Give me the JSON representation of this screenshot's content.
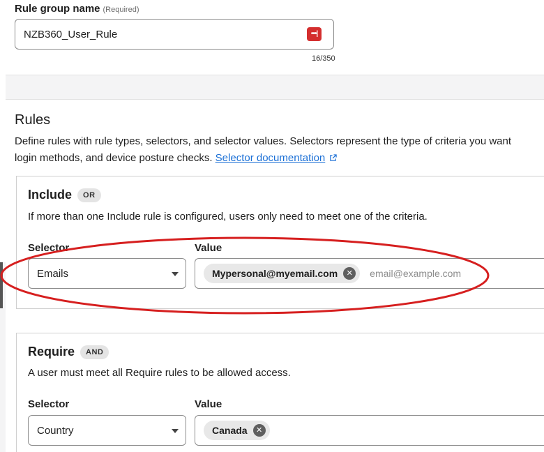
{
  "rule_group": {
    "label": "Rule group name",
    "required": "(Required)",
    "value": "NZB360_User_Rule",
    "counter": "16/350"
  },
  "rules": {
    "title": "Rules",
    "desc_line1": "Define rules with rule types, selectors, and selector values. Selectors represent the type of criteria you want",
    "desc_line2": "login methods, and device posture checks.",
    "doc_link": "Selector documentation"
  },
  "include": {
    "title": "Include",
    "badge": "OR",
    "desc": "If more than one Include rule is configured, users only need to meet one of the criteria.",
    "selector_label": "Selector",
    "value_label": "Value",
    "selector_value": "Emails",
    "chip": "Mypersonal@myemail.com",
    "placeholder": "email@example.com"
  },
  "require": {
    "title": "Require",
    "badge": "AND",
    "desc": "A user must meet all Require rules to be allowed access.",
    "selector_label": "Selector",
    "value_label": "Value",
    "selector_value": "Country",
    "chip": "Canada"
  },
  "colors": {
    "annotation": "#d61f1f",
    "link": "#1a6fd6",
    "password_icon": "#d42e2e"
  },
  "icons": [
    "password-manager-icon",
    "external-link-icon",
    "chevron-down-icon",
    "remove-chip-icon"
  ]
}
